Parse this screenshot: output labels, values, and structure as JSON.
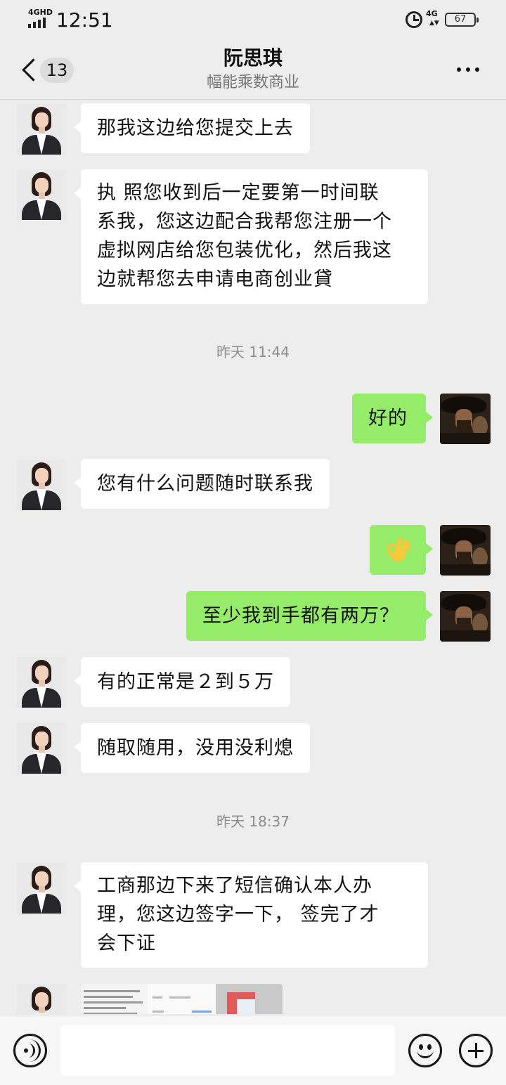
{
  "status_bar": {
    "time": "12:51",
    "network_left": "4GHD",
    "network_right": "4G",
    "battery": "67",
    "icons": [
      "signal-icon",
      "alarm-icon",
      "battery-icon"
    ]
  },
  "header": {
    "back_label": "back",
    "unread_count": "13",
    "title": "阮思琪",
    "subtitle": "幅能乘数商业",
    "more_icon": "more-icon"
  },
  "messages": [
    {
      "sender": "contact",
      "lines": [
        "那我这边给您提交上去"
      ]
    },
    {
      "sender": "contact",
      "lines": [
        "执 照您收到后一定要第一时间联",
        "系我，您这边配合我帮您注册一个",
        "虚拟网店给您包装优化，然后我这",
        "边就帮您去申请电商创业貸"
      ]
    },
    {
      "timestamp": "昨天 11:44"
    },
    {
      "sender": "me",
      "lines": [
        "好的"
      ]
    },
    {
      "sender": "contact",
      "lines": [
        "您有什么问题随时联系我"
      ]
    },
    {
      "sender": "me",
      "emoji": "ok-hand-icon"
    },
    {
      "sender": "me",
      "lines": [
        "至少我到手都有两万？"
      ]
    },
    {
      "sender": "contact",
      "lines": [
        "有的正常是２到５万"
      ]
    },
    {
      "sender": "contact",
      "lines": [
        "随取随用，没用没利熄"
      ]
    },
    {
      "timestamp": "昨天 18:37"
    },
    {
      "sender": "contact",
      "lines": [
        "工商那边下来了短信确认本人办",
        "理，您这边签字一下， 签完了才",
        "会下证"
      ]
    },
    {
      "sender": "contact",
      "image": "document-screenshot-image"
    }
  ],
  "input_bar": {
    "voice_icon": "voice-icon",
    "placeholder": "",
    "emoji_icon": "emoji-icon",
    "plus_icon": "plus-icon"
  },
  "colors": {
    "background": "#ededed",
    "incoming_bubble": "#ffffff",
    "outgoing_bubble": "#95ec69",
    "timestamp_text": "#8c8c8c"
  }
}
